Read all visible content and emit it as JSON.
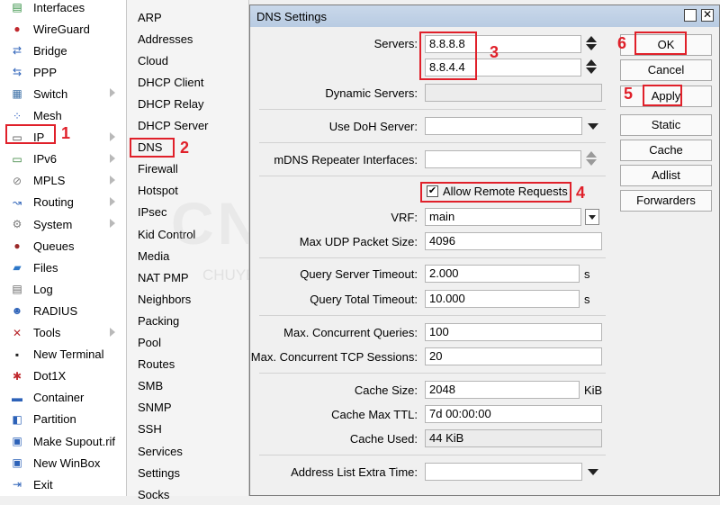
{
  "left_menu": [
    {
      "label": "Interfaces",
      "icon": "interfaces-icon",
      "glyph": "▤",
      "color": "#2a8a3a",
      "arrow": false
    },
    {
      "label": "WireGuard",
      "icon": "wireguard-icon",
      "glyph": "●",
      "color": "#c0282d",
      "arrow": false
    },
    {
      "label": "Bridge",
      "icon": "bridge-icon",
      "glyph": "⇄",
      "color": "#2d62b8",
      "arrow": false
    },
    {
      "label": "PPP",
      "icon": "ppp-icon",
      "glyph": "⇆",
      "color": "#2d62b8",
      "arrow": false
    },
    {
      "label": "Switch",
      "icon": "switch-icon",
      "glyph": "▦",
      "color": "#3a6ea5",
      "arrow": true
    },
    {
      "label": "Mesh",
      "icon": "mesh-icon",
      "glyph": "⁘",
      "color": "#3060c0",
      "arrow": false
    },
    {
      "label": "IP",
      "icon": "ip-icon",
      "glyph": "▭",
      "color": "#444444",
      "arrow": true
    },
    {
      "label": "IPv6",
      "icon": "ipv6-icon",
      "glyph": "▭",
      "color": "#2e7d32",
      "arrow": true
    },
    {
      "label": "MPLS",
      "icon": "mpls-icon",
      "glyph": "⊘",
      "color": "#7a7a7a",
      "arrow": true
    },
    {
      "label": "Routing",
      "icon": "routing-icon",
      "glyph": "↝",
      "color": "#2d62b8",
      "arrow": true
    },
    {
      "label": "System",
      "icon": "system-icon",
      "glyph": "⚙",
      "color": "#7a7a7a",
      "arrow": true
    },
    {
      "label": "Queues",
      "icon": "queues-icon",
      "glyph": "●",
      "color": "#9b2a2a",
      "arrow": false
    },
    {
      "label": "Files",
      "icon": "files-icon",
      "glyph": "▰",
      "color": "#2d77c8",
      "arrow": false
    },
    {
      "label": "Log",
      "icon": "log-icon",
      "glyph": "▤",
      "color": "#666666",
      "arrow": false
    },
    {
      "label": "RADIUS",
      "icon": "radius-icon",
      "glyph": "☻",
      "color": "#2d62b8",
      "arrow": false
    },
    {
      "label": "Tools",
      "icon": "tools-icon",
      "glyph": "✕",
      "color": "#b8282d",
      "arrow": true
    },
    {
      "label": "New Terminal",
      "icon": "terminal-icon",
      "glyph": "▪",
      "color": "#222222",
      "arrow": false
    },
    {
      "label": "Dot1X",
      "icon": "dot1x-icon",
      "glyph": "✱",
      "color": "#c0282d",
      "arrow": false
    },
    {
      "label": "Container",
      "icon": "container-icon",
      "glyph": "▬",
      "color": "#2d62b8",
      "arrow": false
    },
    {
      "label": "Partition",
      "icon": "partition-icon",
      "glyph": "◧",
      "color": "#2d62b8",
      "arrow": false
    },
    {
      "label": "Make Supout.rif",
      "icon": "supout-icon",
      "glyph": "▣",
      "color": "#2d62b8",
      "arrow": false
    },
    {
      "label": "New WinBox",
      "icon": "winbox-icon",
      "glyph": "▣",
      "color": "#2d62b8",
      "arrow": false
    },
    {
      "label": "Exit",
      "icon": "exit-icon",
      "glyph": "⇥",
      "color": "#2d62b8",
      "arrow": false
    }
  ],
  "sub_menu": [
    "ARP",
    "Addresses",
    "Cloud",
    "DHCP Client",
    "DHCP Relay",
    "DHCP Server",
    "DNS",
    "Firewall",
    "Hotspot",
    "IPsec",
    "Kid Control",
    "Media",
    "NAT PMP",
    "Neighbors",
    "Packing",
    "Pool",
    "Routes",
    "SMB",
    "SNMP",
    "SSH",
    "Services",
    "Settings",
    "Socks"
  ],
  "dialog": {
    "title": "DNS Settings",
    "labels": {
      "servers": "Servers:",
      "dynamic_servers": "Dynamic Servers:",
      "use_doh": "Use DoH Server:",
      "mdns": "mDNS Repeater Interfaces:",
      "allow_remote": "Allow Remote Requests",
      "vrf": "VRF:",
      "max_udp": "Max UDP Packet Size:",
      "query_server_timeout": "Query Server Timeout:",
      "query_total_timeout": "Query Total Timeout:",
      "max_concurrent": "Max. Concurrent Queries:",
      "max_tcp": "Max. Concurrent TCP Sessions:",
      "cache_size": "Cache Size:",
      "cache_max_ttl": "Cache Max TTL:",
      "cache_used": "Cache Used:",
      "address_list": "Address List Extra Time:"
    },
    "values": {
      "server1": "8.8.8.8",
      "server2": "8.8.4.4",
      "dynamic_servers": "",
      "use_doh": "",
      "mdns": "",
      "allow_remote_checked": "✔",
      "vrf": "main",
      "max_udp": "4096",
      "query_server_timeout": "2.000",
      "query_total_timeout": "10.000",
      "max_concurrent": "100",
      "max_tcp": "20",
      "cache_size": "2048",
      "cache_max_ttl": "7d 00:00:00",
      "cache_used": "44 KiB",
      "address_list": ""
    },
    "units": {
      "s1": "s",
      "s2": "s",
      "kib": "KiB"
    },
    "buttons": {
      "ok": "OK",
      "cancel": "Cancel",
      "apply": "Apply",
      "static": "Static",
      "cache": "Cache",
      "adlist": "Adlist",
      "forwarders": "Forwarders"
    }
  },
  "annotations": {
    "n1": "1",
    "n2": "2",
    "n3": "3",
    "n4": "4",
    "n5": "5",
    "n6": "6"
  },
  "watermark": {
    "main": "CNTTSHOP.vn",
    "sub": "CHUYÊN NGHIỆP – THÂN THIỆN"
  }
}
